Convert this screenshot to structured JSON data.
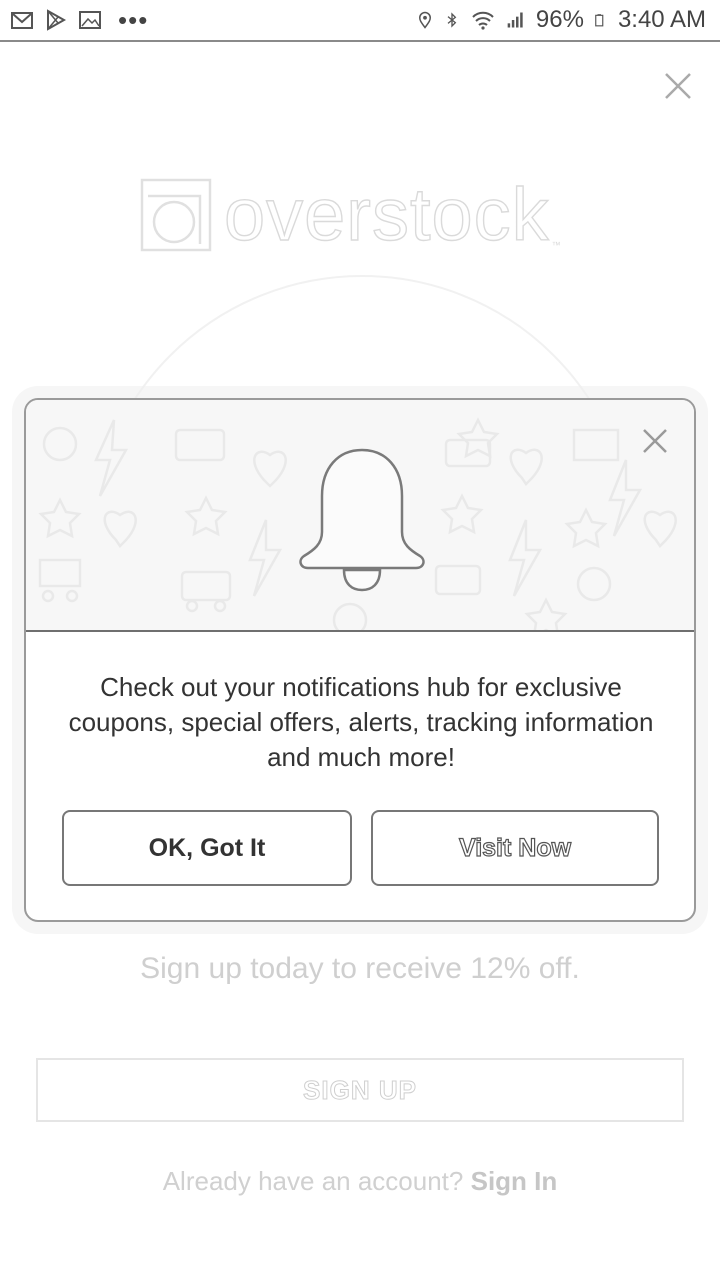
{
  "status_bar": {
    "battery": "96%",
    "time": "3:40 AM",
    "left_icons": [
      "gmail-icon",
      "play-store-icon",
      "gallery-icon",
      "more-dots"
    ],
    "right_icons": [
      "location-icon",
      "bluetooth-icon",
      "wifi-icon",
      "signal-icon",
      "battery-icon"
    ]
  },
  "background_page": {
    "brand": "overstock",
    "offer_text": "Sign up today to receive 12% off.",
    "signup_button": "SIGN UP",
    "account_prompt": "Already have an account?",
    "signin_link": "Sign In"
  },
  "modal": {
    "message": "Check out your notifications hub for exclusive coupons, special offers, alerts, tracking information and much more!",
    "ok_button": "OK, Got It",
    "visit_button": "Visit Now",
    "hero_icon": "bell-icon"
  },
  "colors": {
    "background": "#ffffff",
    "border": "#777777",
    "text": "#333333",
    "muted": "#cfcfcf"
  }
}
